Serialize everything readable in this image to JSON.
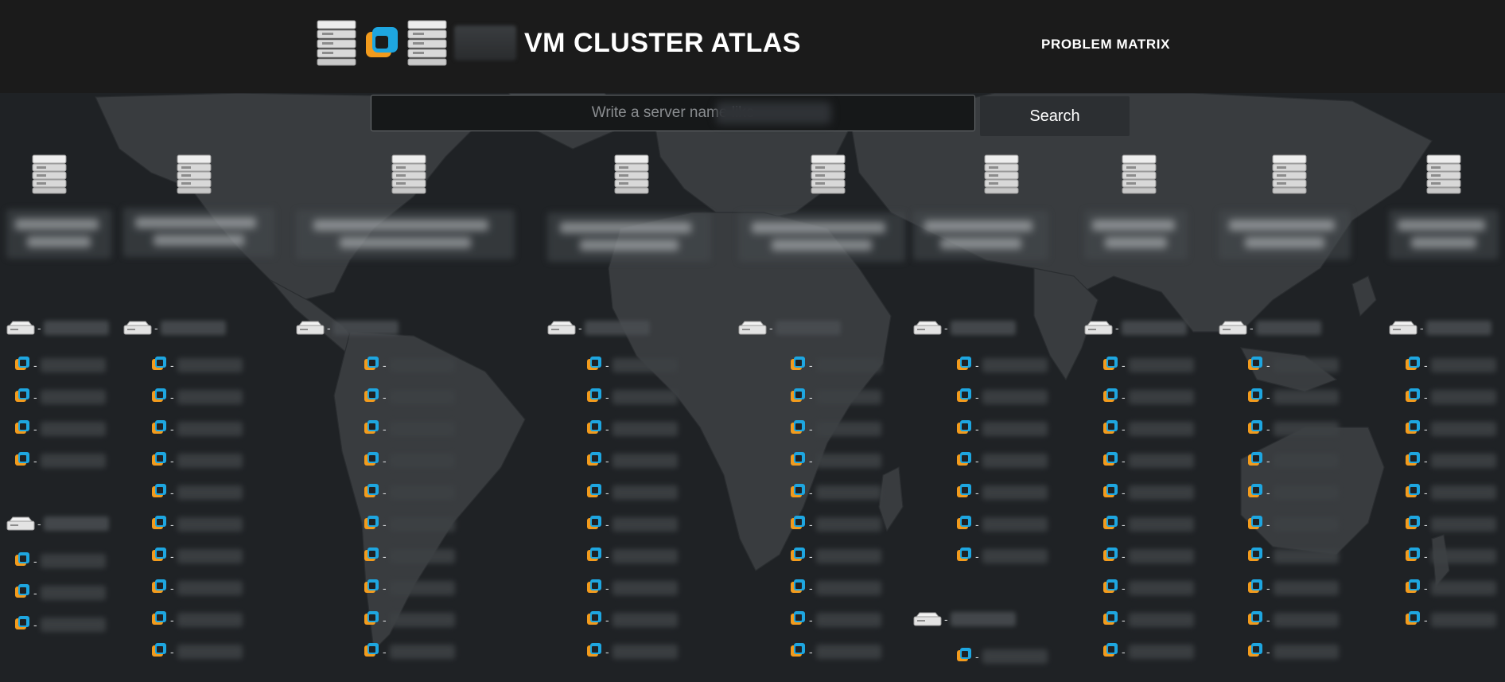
{
  "header": {
    "title": "VM CLUSTER ATLAS",
    "nav_problem_matrix": "PROBLEM MATRIX",
    "logo_icons": [
      "server-rack-icon",
      "vmware-icon",
      "server-rack-icon"
    ]
  },
  "search": {
    "placeholder": "Write a server name like",
    "button_label": "Search"
  },
  "colors": {
    "header_bg": "#1b1b1b",
    "map_bg": "#1f2225",
    "land": "#3a3d40",
    "vm_icon_orange": "#f29b1d",
    "vm_icon_blue": "#1ea6e0"
  },
  "clusters": [
    {
      "name": "",
      "hosts": [
        {
          "name": "",
          "vm_count": 4
        },
        {
          "name": "",
          "vm_count": 3
        }
      ]
    },
    {
      "name": "",
      "hosts": [
        {
          "name": "",
          "vm_count": 11
        }
      ]
    },
    {
      "name": "",
      "hosts": [
        {
          "name": "",
          "vm_count": 11
        }
      ]
    },
    {
      "name": "",
      "hosts": [
        {
          "name": "",
          "vm_count": 11
        }
      ]
    },
    {
      "name": "",
      "hosts": [
        {
          "name": "",
          "vm_count": 11
        }
      ]
    },
    {
      "name": "",
      "hosts": [
        {
          "name": "",
          "vm_count": 7
        },
        {
          "name": "",
          "vm_count": 1
        }
      ]
    },
    {
      "name": "",
      "hosts": [
        {
          "name": "",
          "vm_count": 11
        }
      ]
    },
    {
      "name": "",
      "hosts": [
        {
          "name": "",
          "vm_count": 11
        }
      ]
    },
    {
      "name": "",
      "hosts": [
        {
          "name": "",
          "vm_count": 9
        }
      ]
    }
  ]
}
